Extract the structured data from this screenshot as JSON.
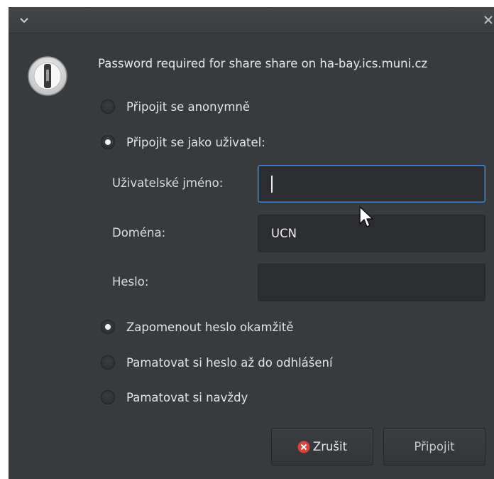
{
  "titlebar": {
    "menu_icon": "chevron-down-icon",
    "close_icon": "close-icon"
  },
  "dialog": {
    "icon": "key-icon",
    "message": "Password required for share share on ha-bay.ics.muni.cz"
  },
  "connect_mode": {
    "options": [
      {
        "label": "Připojit se anonymně",
        "checked": false
      },
      {
        "label": "Připojit se jako uživatel:",
        "checked": true
      }
    ]
  },
  "fields": {
    "username": {
      "label": "Uživatelské jméno:",
      "value": ""
    },
    "domain": {
      "label": "Doména:",
      "value": "UCN"
    },
    "password": {
      "label": "Heslo:",
      "value": ""
    }
  },
  "remember": {
    "options": [
      {
        "label": "Zapomenout heslo okamžitě",
        "checked": true
      },
      {
        "label": "Pamatovat si heslo až do odhlášení",
        "checked": false
      },
      {
        "label": "Pamatovat si navždy",
        "checked": false
      }
    ]
  },
  "buttons": {
    "cancel_label": "Zrušit",
    "connect_label": "Připojit"
  },
  "colors": {
    "window_bg": "#383b3e",
    "focus_accent": "#4a90d9",
    "cancel_icon": "#e0403a"
  }
}
